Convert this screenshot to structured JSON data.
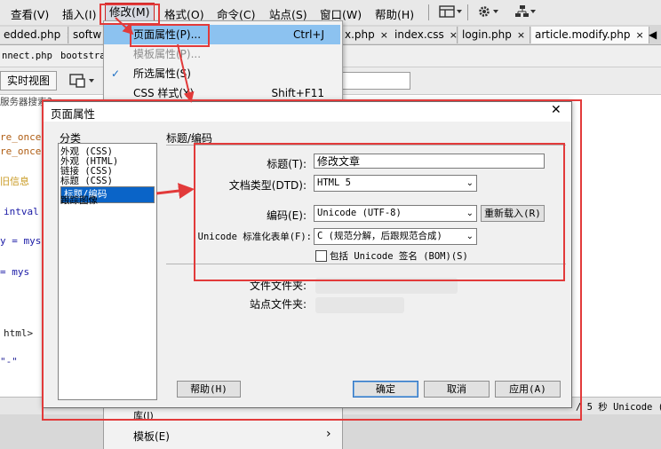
{
  "menubar": {
    "items": [
      "查看(V)",
      "插入(I)",
      "修改(M)",
      "格式(O)",
      "命令(C)",
      "站点(S)",
      "窗口(W)",
      "帮助(H)"
    ],
    "layout_icon": "layout-icon",
    "gear_icon": "gear-icon",
    "sitemap_icon": "sitemap-icon",
    "caret": "▾"
  },
  "tabs": [
    "edded.php",
    "softw",
    "x.php",
    "index.css",
    "login.php",
    "article.modify.php"
  ],
  "tab_close": "×",
  "related_files": [
    "nnect.php",
    "bootstra"
  ],
  "doc_toolbar": {
    "live_view": "实时视图"
  },
  "dropdown": {
    "items": [
      {
        "label": "页面属性(P)...",
        "shortcut": "Ctrl+J"
      },
      {
        "label": "模板属性(P)...",
        "shortcut": ""
      },
      {
        "label": "所选属性(S)",
        "shortcut": ""
      },
      {
        "label": "CSS 样式(Y)",
        "shortcut": "Shift+F11"
      }
    ],
    "bottom_item": "模板(E)",
    "bottom_partial": "库(I)",
    "checkmark": "✓",
    "submenu_arrow": "›"
  },
  "code_lines": [
    "re_once",
    "re_once",
    "旧信息",
    "intval",
    "y = mys",
    "= mys",
    "html>",
    "\"-\"",
    "服务器搜索?"
  ],
  "dialog": {
    "title": "页面属性",
    "close": "✕",
    "category_label": "分类",
    "categories": [
      "外观 (CSS)",
      "外观 (HTML)",
      "链接 (CSS)",
      "标题 (CSS)",
      "标题/编码",
      "跟踪图像"
    ],
    "section_title": "标题/编码",
    "title_label": "标题(T):",
    "title_value": "修改文章",
    "doctype_label": "文档类型(DTD):",
    "doctype_value": "HTML 5",
    "encoding_label": "编码(E):",
    "encoding_value": "Unicode (UTF-8)",
    "reload_button": "重新载入(R)",
    "normalize_label": "Unicode 标准化表单(F):",
    "normalize_value": "C (规范分解，后跟规范合成)",
    "bom_label": "包括 Unicode 签名 (BOM)(S)",
    "doc_folder_label": "文件文件夹:",
    "site_folder_label": "站点文件夹:",
    "help_button": "帮助(H)",
    "ok_button": "确定",
    "cancel_button": "取消",
    "apply_button": "应用(A)"
  },
  "status_right": "/ 5 秒 Unicode (",
  "colors": {
    "highlight": "#8cc2f0",
    "selected": "#0a64c8",
    "annotation": "#e23a3a"
  }
}
